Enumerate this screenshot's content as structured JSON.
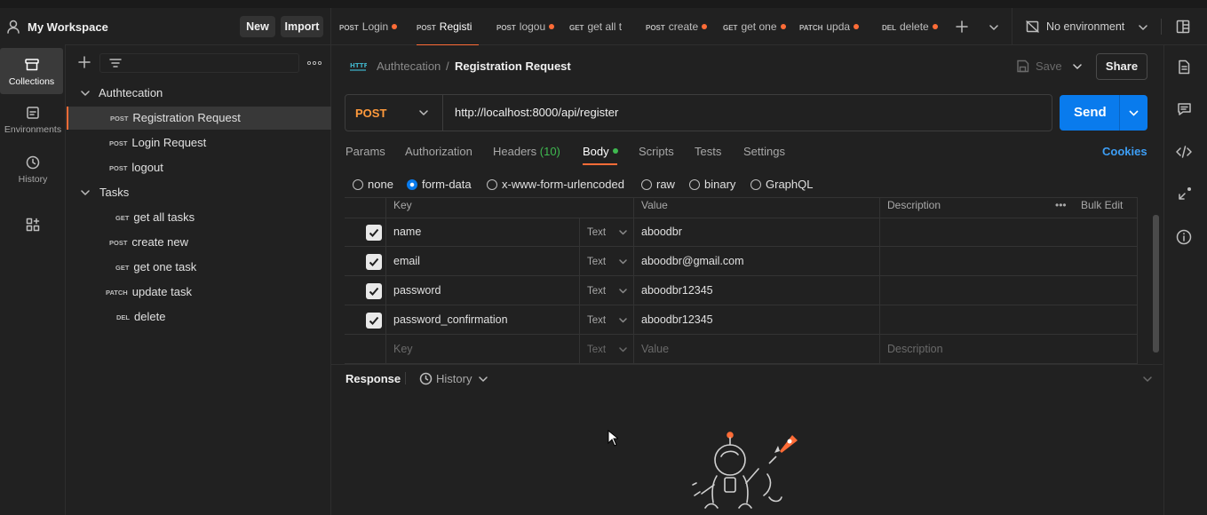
{
  "workspace": {
    "name": "My Workspace",
    "new_label": "New",
    "import_label": "Import"
  },
  "rail": {
    "collections": "Collections",
    "environments": "Environments",
    "history": "History"
  },
  "tree": {
    "folders": [
      {
        "name": "Authtecation"
      },
      {
        "name": "Tasks"
      }
    ],
    "items": [
      {
        "method": "POST",
        "name": "Registration Request"
      },
      {
        "method": "POST",
        "name": "Login Request"
      },
      {
        "method": "POST",
        "name": "logout"
      },
      {
        "method": "GET",
        "name": "get all tasks"
      },
      {
        "method": "POST",
        "name": "create new"
      },
      {
        "method": "GET",
        "name": "get one task"
      },
      {
        "method": "PATCH",
        "name": "update task"
      },
      {
        "method": "DEL",
        "name": "delete"
      }
    ]
  },
  "tabs": [
    {
      "method": "POST",
      "name": "Login"
    },
    {
      "method": "POST",
      "name": "Registi"
    },
    {
      "method": "POST",
      "name": "logou"
    },
    {
      "method": "GET",
      "name": "get all t"
    },
    {
      "method": "POST",
      "name": "create"
    },
    {
      "method": "GET",
      "name": "get one"
    },
    {
      "method": "PATCH",
      "name": "upda"
    },
    {
      "method": "DEL",
      "name": "delete"
    }
  ],
  "environment": {
    "label": "No environment"
  },
  "request": {
    "breadcrumb_parent": "Authtecation",
    "breadcrumb_sep": "/",
    "title": "Registration Request",
    "save_label": "Save",
    "share_label": "Share",
    "method": "POST",
    "url": "http://localhost:8000/api/register",
    "send_label": "Send",
    "cookies_label": "Cookies",
    "http_badge": "HTTP"
  },
  "req_tabs": {
    "params": "Params",
    "authorization": "Authorization",
    "headers": "Headers",
    "headers_count": "(10)",
    "body": "Body",
    "scripts": "Scripts",
    "tests": "Tests",
    "settings": "Settings"
  },
  "body_types": {
    "none": "none",
    "form_data": "form-data",
    "urlencoded": "x-www-form-urlencoded",
    "raw": "raw",
    "binary": "binary",
    "graphql": "GraphQL",
    "selected": "form-data"
  },
  "table": {
    "headers": {
      "key": "Key",
      "value": "Value",
      "description": "Description",
      "bulk_edit": "Bulk Edit"
    },
    "rows": [
      {
        "key": "name",
        "type": "Text",
        "value": "aboodbr",
        "checked": true
      },
      {
        "key": "email",
        "type": "Text",
        "value": "aboodbr@gmail.com",
        "checked": true
      },
      {
        "key": "password",
        "type": "Text",
        "value": "aboodbr12345",
        "checked": true
      },
      {
        "key": "password_confirmation",
        "type": "Text",
        "value": "aboodbr12345",
        "checked": true
      }
    ],
    "placeholder": {
      "key": "Key",
      "type": "Text",
      "value": "Value",
      "description": "Description"
    }
  },
  "response": {
    "label": "Response",
    "history_label": "History"
  },
  "colors": {
    "accent": "#ff6c37",
    "send": "#097bed",
    "headers_count": "#3fb950",
    "body_dot": "#3fb950"
  }
}
